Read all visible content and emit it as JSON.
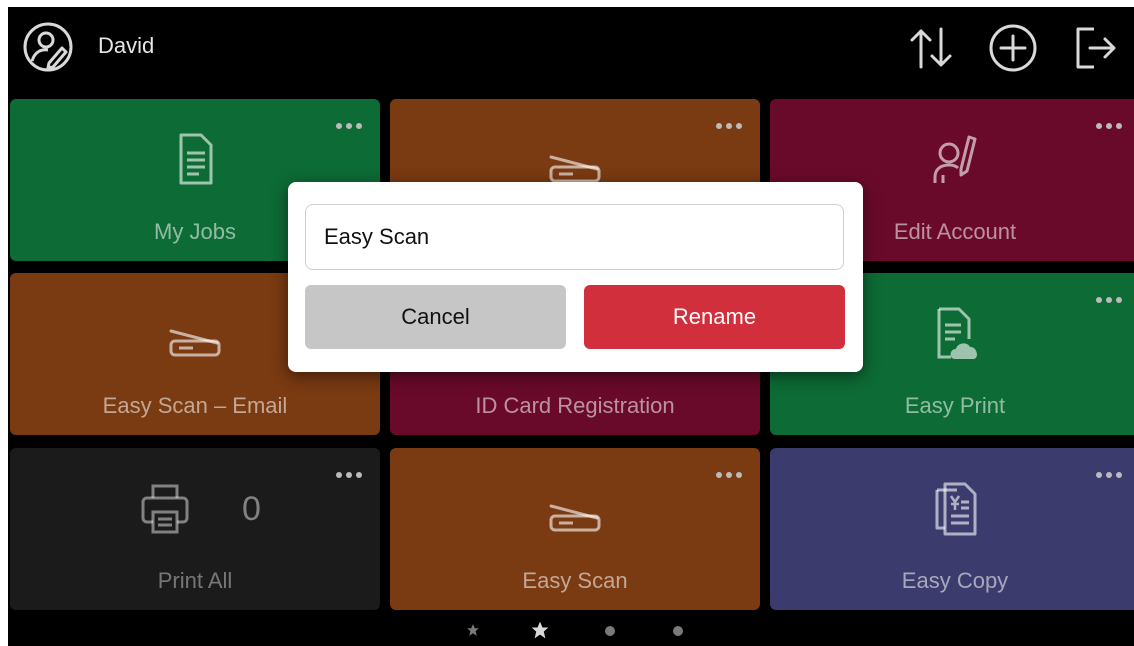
{
  "header": {
    "user_name": "David",
    "icons": [
      "user-edit-icon",
      "sort-icon",
      "add-icon",
      "logout-icon"
    ]
  },
  "tiles": [
    {
      "label": "My Jobs",
      "icon": "document-icon",
      "color": "#0d6b35"
    },
    {
      "label": "",
      "icon": "scanner-icon",
      "color": "#7a3a12"
    },
    {
      "label": "Edit Account",
      "icon": "user-edit-icon",
      "color": "#6a0a2a"
    },
    {
      "label": "Easy Scan – Email",
      "icon": "scanner-icon",
      "color": "#7a3a12"
    },
    {
      "label": "ID Card Registration",
      "icon": "id-card-icon",
      "color": "#6a0a2a"
    },
    {
      "label": "Easy Print",
      "icon": "cloud-document-icon",
      "color": "#0d6b35"
    },
    {
      "label": "Print All",
      "icon": "printer-icon",
      "color": "#1b1b1b",
      "count": "0"
    },
    {
      "label": "Easy Scan",
      "icon": "scanner-icon",
      "color": "#7a3a12"
    },
    {
      "label": "Easy Copy",
      "icon": "copy-icon",
      "color": "#3b3b6d"
    }
  ],
  "pager": {
    "items": [
      "star-icon",
      "star-icon",
      "dot-icon",
      "dot-icon"
    ],
    "active_index": 1
  },
  "dialog": {
    "input_value": "Easy Scan",
    "cancel_label": "Cancel",
    "rename_label": "Rename"
  }
}
